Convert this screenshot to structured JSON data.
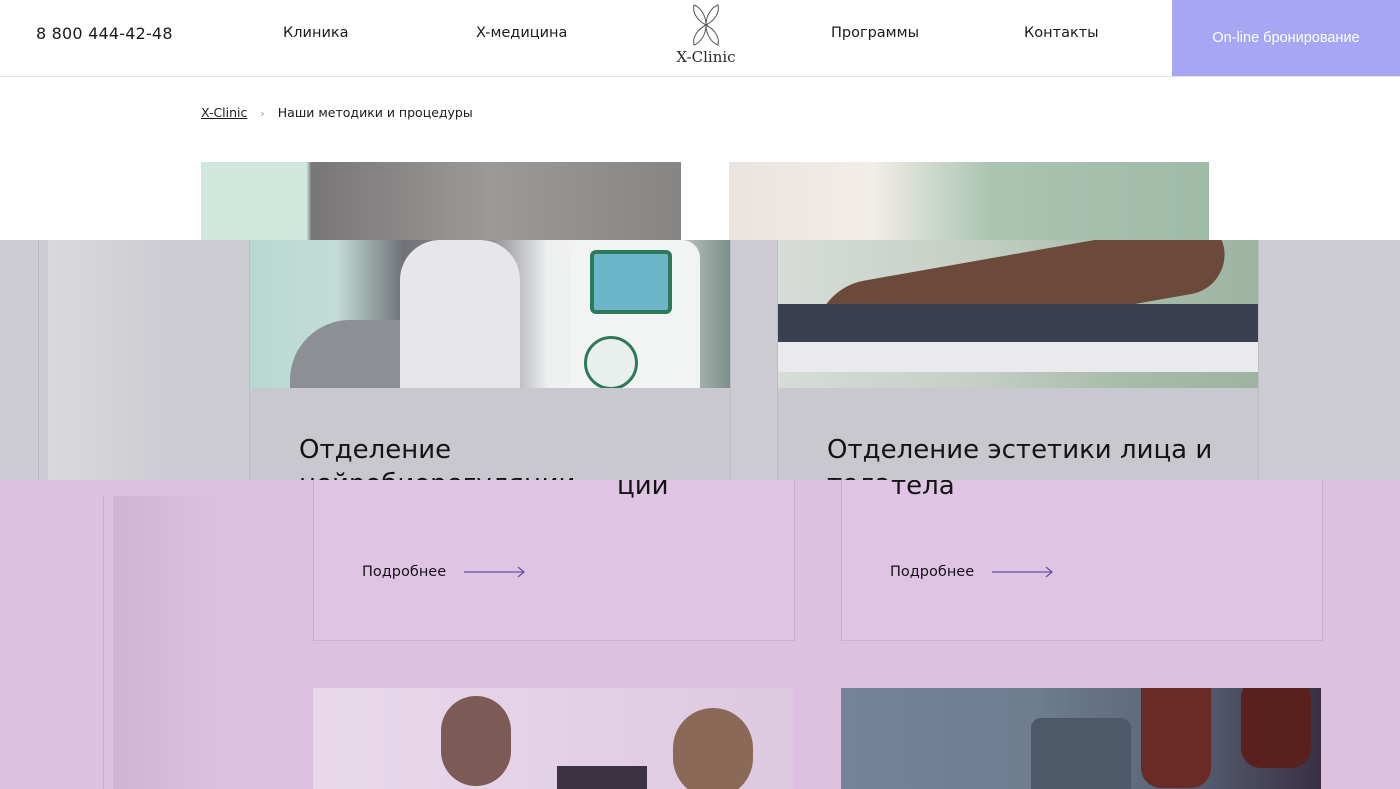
{
  "header": {
    "phone": "8 800 444-42-48",
    "nav": {
      "clinic": "Клиника",
      "xmed": "X-медицина",
      "programs": "Программы",
      "contacts": "Контакты"
    },
    "logo_text": "X-Clinic",
    "booking_label": "On-line бронирование"
  },
  "breadcrumb": {
    "home": "X-Clinic",
    "current": "Наши методики и процедуры"
  },
  "cards": [
    {
      "title": "Отделение нейробиорегуляции",
      "title_tail": "ции",
      "more_label": "Подробнее"
    },
    {
      "title": "Отделение эстетики лица и тела",
      "title_tail": "тела",
      "more_label": "Подробнее"
    }
  ],
  "icons": {
    "logo": "butterfly-leaf-icon",
    "breadcrumb_separator": "chevron-right-icon",
    "more_arrow": "arrow-right-icon"
  },
  "colors": {
    "booking_bg": "#a6a6f4",
    "arrow": "#6a52a8",
    "overlay_gray": "#ccccd2",
    "overlay_purple": "#dcc1e1"
  }
}
